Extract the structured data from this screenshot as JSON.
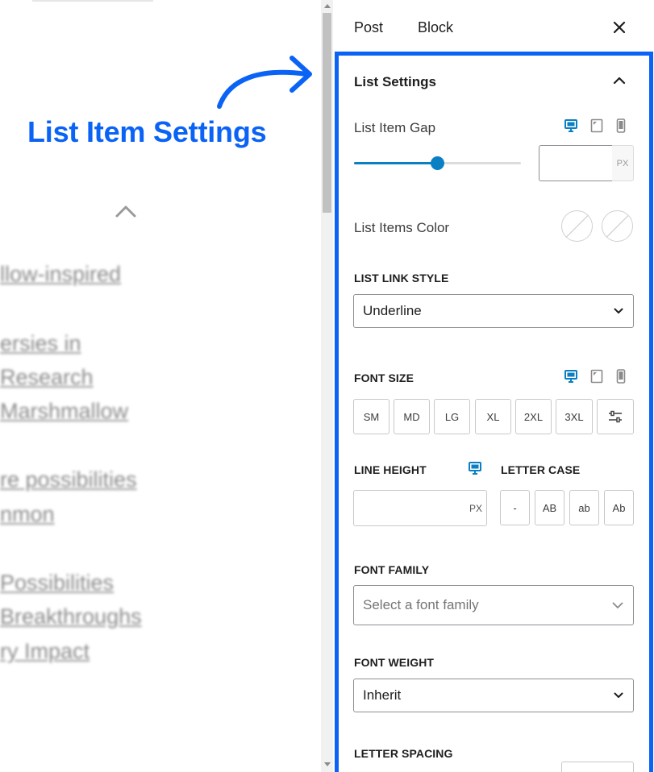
{
  "annotation": {
    "text": "List Item Settings",
    "color": "#0b63f6"
  },
  "canvas": {
    "lines": [
      "llow-inspired",
      "ersies in",
      "Research",
      "Marshmallow",
      "re possibilities",
      "nmon",
      "Possibilities",
      "Breakthroughs",
      "ry Impact"
    ]
  },
  "sidebar": {
    "tabs": [
      {
        "label": "Post"
      },
      {
        "label": "Block"
      }
    ],
    "close_icon": "close-icon"
  },
  "panel": {
    "title": "List Settings",
    "accent": "#0b7fc4",
    "highlight": "#0b63f6",
    "list_item_gap": {
      "label": "List Item Gap",
      "slider_fraction": 0.5,
      "value": "",
      "unit": "PX"
    },
    "list_items_color": {
      "label": "List Items Color"
    },
    "list_link_style": {
      "label": "LIST LINK STYLE",
      "selected": "Underline"
    },
    "font_size": {
      "label": "FONT SIZE",
      "options": [
        "SM",
        "MD",
        "LG",
        "XL",
        "2XL",
        "3XL"
      ],
      "custom_icon": "sliders-icon"
    },
    "line_height": {
      "label": "LINE HEIGHT",
      "value": "",
      "unit": "PX"
    },
    "letter_case": {
      "label": "LETTER CASE",
      "options": [
        "-",
        "AB",
        "ab",
        "Ab"
      ]
    },
    "font_family": {
      "label": "FONT FAMILY",
      "placeholder": "Select a font family"
    },
    "font_weight": {
      "label": "FONT WEIGHT",
      "selected": "Inherit"
    },
    "letter_spacing": {
      "label": "LETTER SPACING"
    }
  }
}
